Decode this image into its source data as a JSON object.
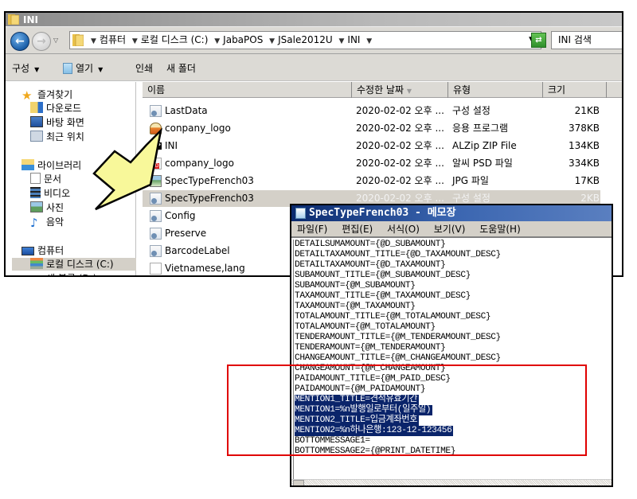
{
  "explorer": {
    "title": "INI",
    "breadcrumb": [
      "컴퓨터",
      "로컬 디스크 (C:)",
      "JabaPOS",
      "JSale2012U",
      "INI"
    ],
    "search_placeholder": "INI 검색",
    "toolbar": {
      "organize": "구성",
      "open": "열기",
      "print": "인쇄",
      "new_folder": "새 폴더"
    },
    "nav": {
      "favorites": "즐겨찾기",
      "downloads": "다운로드",
      "desktop": "바탕 화면",
      "recent": "최근 위치",
      "libraries": "라이브러리",
      "documents": "문서",
      "videos": "비디오",
      "pictures": "사진",
      "music": "음악",
      "computer": "컴퓨터",
      "local_disk": "로컬 디스크 (C:)",
      "partial_item": "새 볼륨 (D:)"
    },
    "columns": {
      "name": "이름",
      "date": "수정한 날짜",
      "type": "유형",
      "size": "크기"
    },
    "files": [
      {
        "name": "LastData",
        "date": "2020-02-02 오후 ...",
        "type": "구성 설정",
        "size": "21KB",
        "icon": "config-file"
      },
      {
        "name": "conpany_logo",
        "date": "2020-02-02 오후 ...",
        "type": "응용 프로그램",
        "size": "378KB",
        "icon": "application"
      },
      {
        "name": "INI",
        "date": "2020-02-02 오후 ...",
        "type": "ALZip ZIP File",
        "size": "134KB",
        "icon": "zip-file"
      },
      {
        "name": "company_logo",
        "date": "2020-02-02 오후 ...",
        "type": "알씨 PSD 파일",
        "size": "334KB",
        "icon": "psd-file"
      },
      {
        "name": "SpecTypeFrench03",
        "date": "2020-02-02 오후 ...",
        "type": "JPG 파일",
        "size": "17KB",
        "icon": "image-file"
      },
      {
        "name": "SpecTypeFrench03",
        "date": "2020-02-02 오후 ...",
        "type": "구성 설정",
        "size": "2KB",
        "icon": "config-file",
        "selected": true
      },
      {
        "name": "Config",
        "date": "",
        "type": "",
        "size": "",
        "icon": "config-file"
      },
      {
        "name": "Preserve",
        "date": "",
        "type": "",
        "size": "",
        "icon": "config-file"
      },
      {
        "name": "BarcodeLabel",
        "date": "",
        "type": "",
        "size": "",
        "icon": "config-file"
      },
      {
        "name": "Vietnamese,lang",
        "date": "",
        "type": "",
        "size": "",
        "icon": "blank-file"
      }
    ]
  },
  "notepad": {
    "title": "SpecTypeFrench03 - 메모장",
    "menu": [
      "파일(F)",
      "편집(E)",
      "서식(O)",
      "보기(V)",
      "도움말(H)"
    ],
    "lines": [
      "DETAILSUMAMOUNT={@D_SUBAMOUNT}",
      "DETAILTAXAMOUNT_TITLE={@D_TAXAMOUNT_DESC}",
      "DETAILTAXAMOUNT={@D_TAXAMOUNT}",
      "SUBAMOUNT_TITLE={@M_SUBAMOUNT_DESC}",
      "SUBAMOUNT={@M_SUBAMOUNT}",
      "TAXAMOUNT_TITLE={@M_TAXAMOUNT_DESC}",
      "TAXAMOUNT={@M_TAXAMOUNT}",
      "TOTALAMOUNT_TITLE={@M_TOTALAMOUNT_DESC}",
      "TOTALAMOUNT={@M_TOTALAMOUNT}",
      "TENDERAMOUNT_TITLE={@M_TENDERAMOUNT_DESC}",
      "TENDERAMOUNT={@M_TENDERAMOUNT}",
      "CHANGEAMOUNT_TITLE={@M_CHANGEAMOUNT_DESC}",
      "CHANGEAMOUNT={@M_CHANGEAMOUNT}",
      "PAIDAMOUNT_TITLE={@M_PAID_DESC}",
      "PAIDAMOUNT={@M_PAIDAMOUNT}",
      "MENTION1_TITLE=견적유효기간",
      "MENTION1=%n발행일로부터(일주일)",
      "MENTION2_TITLE=입금계좌번호",
      "MENTION2=%n하나은행:123-12-123456",
      "BOTTOMMESSAGE1=",
      "BOTTOMMESSAGE2={@PRINT_DATETIME}"
    ],
    "selected_lines": [
      15,
      16,
      17,
      18
    ]
  },
  "annotation": {
    "highlight_color": "#e00000",
    "arrow_color": "#f8f89a"
  }
}
